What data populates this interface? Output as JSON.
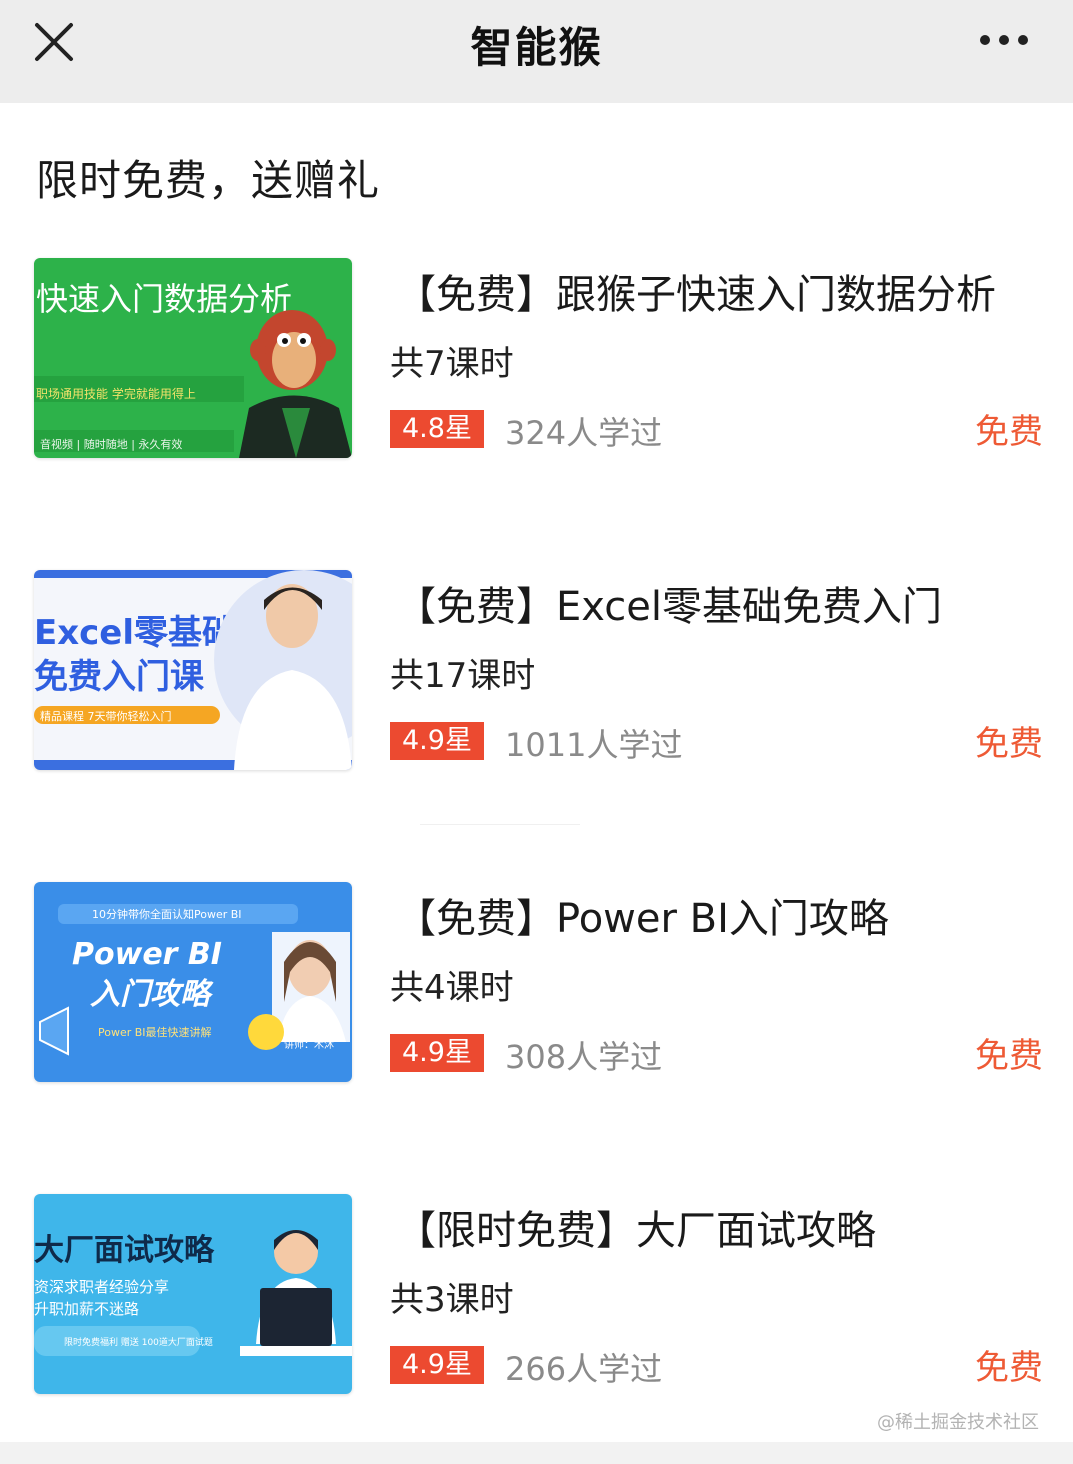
{
  "nav": {
    "title": "智能猴",
    "close_icon": "close-icon",
    "more_icon": "more-dots-icon"
  },
  "section": {
    "title": "限时免费，送赠礼"
  },
  "courses": [
    {
      "title": "【免费】跟猴子快速入门数据分析",
      "lessons": "共7课时",
      "rating": "4.8星",
      "learners": "324人学过",
      "price": "免费",
      "thumb": {
        "headline": "快速入门数据分析",
        "line1": "职场通用技能 学完就能用得上",
        "line2": "音视频 | 随时随地 | 永久有效"
      }
    },
    {
      "title": "【免费】Excel零基础免费入门",
      "lessons": "共17课时",
      "rating": "4.9星",
      "learners": "1011人学过",
      "price": "免费",
      "thumb": {
        "headline1": "Excel零基础",
        "headline2": "免费入门课",
        "tag": "精品课程 7天带你轻松入门"
      }
    },
    {
      "title": "【免费】Power BI入门攻略",
      "lessons": "共4课时",
      "rating": "4.9星",
      "learners": "308人学过",
      "price": "免费",
      "thumb": {
        "top": "10分钟带你全面认知Power BI",
        "headline1": "Power BI",
        "headline2": "入门攻略",
        "sub": "Power BI最佳快速讲解",
        "speaker": "讲师：木沐"
      }
    },
    {
      "title": "【限时免费】大厂面试攻略",
      "lessons": "共3课时",
      "rating": "4.9星",
      "learners": "266人学过",
      "price": "免费",
      "thumb": {
        "headline": "大厂面试攻略",
        "line1": "资深求职者经验分享",
        "line2": "升职加薪不迷路",
        "tag": "限时免费福利 赠送 100道大厂面试题"
      }
    }
  ],
  "watermark": "@稀土掘金技术社区",
  "colors": {
    "nav_bg": "#ededed",
    "rating_bg": "#ec4a30",
    "price": "#ee5a35",
    "learners": "#8a8a8a"
  }
}
